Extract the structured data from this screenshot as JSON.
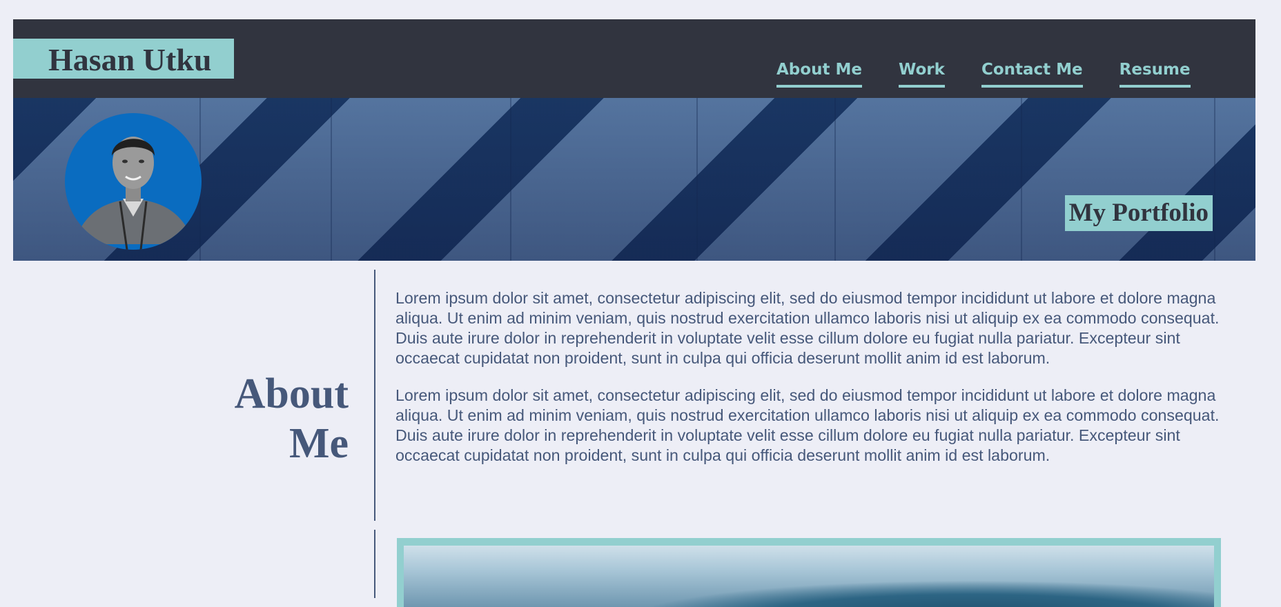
{
  "header": {
    "brand": "Hasan Utku",
    "nav": [
      {
        "label": "About Me"
      },
      {
        "label": "Work"
      },
      {
        "label": "Contact Me"
      },
      {
        "label": "Resume"
      }
    ]
  },
  "banner": {
    "tagline": "My Portfolio"
  },
  "about": {
    "heading_line1": "About",
    "heading_line2": "Me",
    "paragraphs": [
      "Lorem ipsum dolor sit amet, consectetur adipiscing elit, sed do eiusmod tempor incididunt ut labore et dolore magna aliqua. Ut enim ad minim veniam, quis nostrud exercitation ullamco laboris nisi ut aliquip ex ea commodo consequat. Duis aute irure dolor in reprehenderit in voluptate velit esse cillum dolore eu fugiat nulla pariatur. Excepteur sint occaecat cupidatat non proident, sunt in culpa qui officia deserunt mollit anim id est laborum.",
      "Lorem ipsum dolor sit amet, consectetur adipiscing elit, sed do eiusmod tempor incididunt ut labore et dolore magna aliqua. Ut enim ad minim veniam, quis nostrud exercitation ullamco laboris nisi ut aliquip ex ea commodo consequat. Duis aute irure dolor in reprehenderit in voluptate velit esse cillum dolore eu fugiat nulla pariatur. Excepteur sint occaecat cupidatat non proident, sunt in culpa qui officia deserunt mollit anim id est laborum."
    ]
  },
  "colors": {
    "header_bg": "#31343f",
    "accent": "#92cfcf",
    "text": "#46587a",
    "page_bg": "#edeef6",
    "avatar_bg": "#0a6cc0"
  }
}
